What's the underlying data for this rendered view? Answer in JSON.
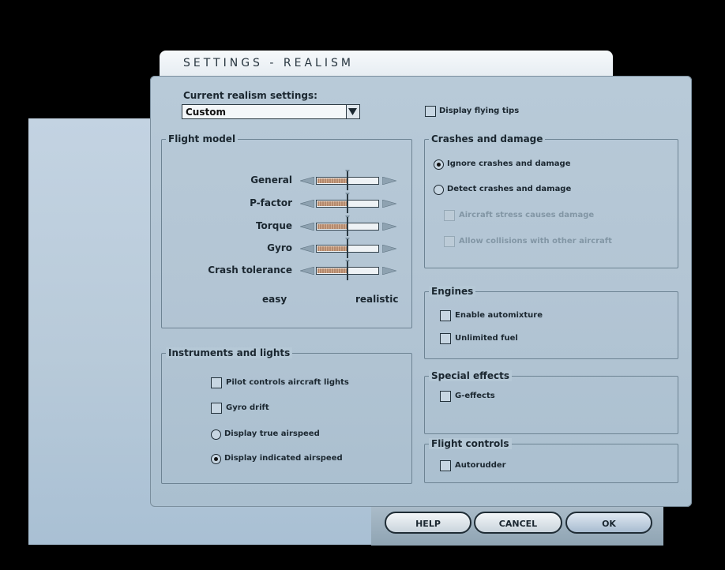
{
  "header": {
    "title": "SETTINGS - REALISM"
  },
  "realism": {
    "label": "Current realism settings:",
    "selected": "Custom",
    "display_tips_label": "Display flying tips",
    "display_tips_checked": false
  },
  "flight_model": {
    "legend": "Flight model",
    "sliders": [
      {
        "label": "General",
        "value": 0.5
      },
      {
        "label": "P-factor",
        "value": 0.5
      },
      {
        "label": "Torque",
        "value": 0.5
      },
      {
        "label": "Gyro",
        "value": 0.5
      },
      {
        "label": "Crash tolerance",
        "value": 0.5
      }
    ],
    "scale_min": "easy",
    "scale_max": "realistic"
  },
  "instruments": {
    "legend": "Instruments and lights",
    "pilot_lights": {
      "label": "Pilot controls aircraft lights",
      "checked": false
    },
    "gyro_drift": {
      "label": "Gyro drift",
      "checked": false
    },
    "true_airspeed": {
      "label": "Display true airspeed",
      "selected": false
    },
    "indicated_airspeed": {
      "label": "Display indicated airspeed",
      "selected": true
    }
  },
  "crashes": {
    "legend": "Crashes and damage",
    "ignore": {
      "label": "Ignore crashes and damage",
      "selected": true
    },
    "detect": {
      "label": "Detect crashes and damage",
      "selected": false
    },
    "stress": {
      "label": "Aircraft stress causes damage",
      "enabled": false
    },
    "collisions": {
      "label": "Allow collisions with other aircraft",
      "enabled": false
    }
  },
  "engines": {
    "legend": "Engines",
    "automixture": {
      "label": "Enable automixture",
      "checked": false
    },
    "fuel": {
      "label": "Unlimited fuel",
      "checked": false
    }
  },
  "special_effects": {
    "legend": "Special effects",
    "g_effects": {
      "label": "G-effects",
      "checked": false
    }
  },
  "flight_controls": {
    "legend": "Flight controls",
    "autorudder": {
      "label": "Autorudder",
      "checked": false
    }
  },
  "buttons": {
    "help": "HELP",
    "cancel": "CANCEL",
    "ok": "OK"
  },
  "colors": {
    "panel": "#b5c8d6",
    "background": "#000000",
    "accent": "#1b2730"
  }
}
